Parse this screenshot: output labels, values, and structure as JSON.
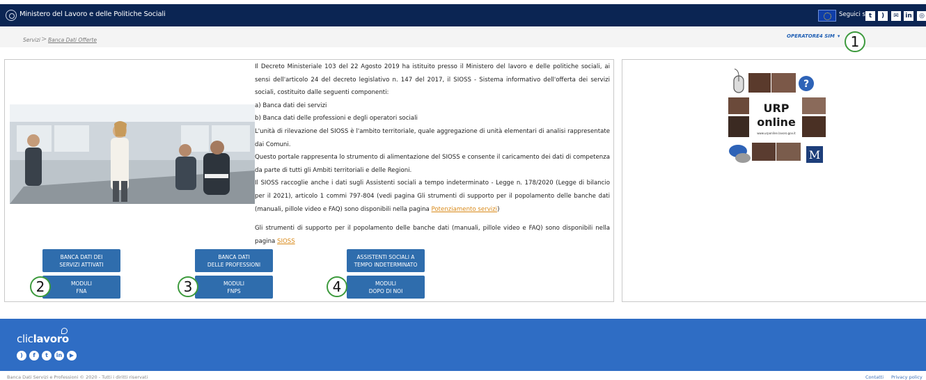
{
  "topbar": {
    "ministry": "Ministero del Lavoro e delle Politiche Sociali",
    "follow_label": "Seguici su:",
    "social_icons": [
      "twitter-icon",
      "rss-icon",
      "email-icon",
      "linkedin-icon",
      "instagram-icon"
    ],
    "background_color": "#0b2553"
  },
  "breadcrumb": {
    "root": "Servizi",
    "separator": ">",
    "current": "Banca Dati Offerte"
  },
  "user_menu": {
    "label": "OPERATORE4 SIM",
    "caret": "▾"
  },
  "callouts": [
    "1",
    "2",
    "3",
    "4"
  ],
  "intro": {
    "p1": "Il Decreto Ministeriale 103 del 22 Agosto 2019 ha istituito presso il Ministero del lavoro e delle politiche sociali, ai sensi dell'articolo 24 del decreto legislativo n. 147 del 2017, il SIOSS - Sistema informativo dell'offerta dei servizi sociali, costituito dalle seguenti componenti:",
    "item_a": "a) Banca dati dei servizi",
    "item_b": "b) Banca dati delle professioni e degli operatori sociali",
    "p2": "L'unità di rilevazione del SIOSS è l'ambito territoriale, quale aggregazione di unità elementari di analisi rappresentate dai Comuni.",
    "p3": "Questo portale rappresenta lo strumento di alimentazione del SIOSS e consente il caricamento dei dati di competenza da parte di tutti gli Ambiti territoriali e delle Regioni.",
    "p4": "Il SIOSS raccoglie anche i dati sugli Assistenti sociali a tempo indeterminato - Legge n. 178/2020 (Legge di bilancio per il 2021), articolo 1 commi 797-804 (vedi pagina Gli strumenti di supporto per il popolamento delle banche dati (manuali, pillole video e FAQ) sono disponibili nella pagina",
    "p4_link": "Potenziamento servizi",
    "p4_end": ")",
    "p5": "Gli strumenti di supporto per il popolamento delle banche dati (manuali, pillole video e FAQ) sono disponibili nella pagina",
    "p5_link": "SIOSS"
  },
  "buttons": {
    "servizi_line1": "BANCA DATI DEI",
    "servizi_line2": "SERVIZI ATTIVATI",
    "professioni_line1": "BANCA DATI",
    "professioni_line2": "DELLE PROFESSIONI",
    "assistenti_line1": "ASSISTENTI SOCIALI A",
    "assistenti_line2": "TEMPO INDETERMINATO",
    "fna_line1": "MODULI",
    "fna_line2": "FNA",
    "fnps_line1": "MODULI",
    "fnps_line2": "FNPS",
    "dopo_line1": "MODULI",
    "dopo_line2": "DOPO DI NOI",
    "color": "#2f6dad"
  },
  "urp": {
    "line1": "URP",
    "line2": "online",
    "url": "www.urponline.lavoro.gov.it",
    "question": "?",
    "badge": "M"
  },
  "footer": {
    "brand_prefix": "clic",
    "brand_bold": "lavoro",
    "social_icons": [
      "rss-icon",
      "facebook-icon",
      "twitter-icon",
      "linkedin-icon",
      "youtube-icon"
    ],
    "copyright": "Banca Dati Servizi e Professioni © 2020 - Tutti i diritti riservati",
    "contacts": "Contatti",
    "privacy": "Privacy policy",
    "background_color": "#2f6dc4"
  }
}
